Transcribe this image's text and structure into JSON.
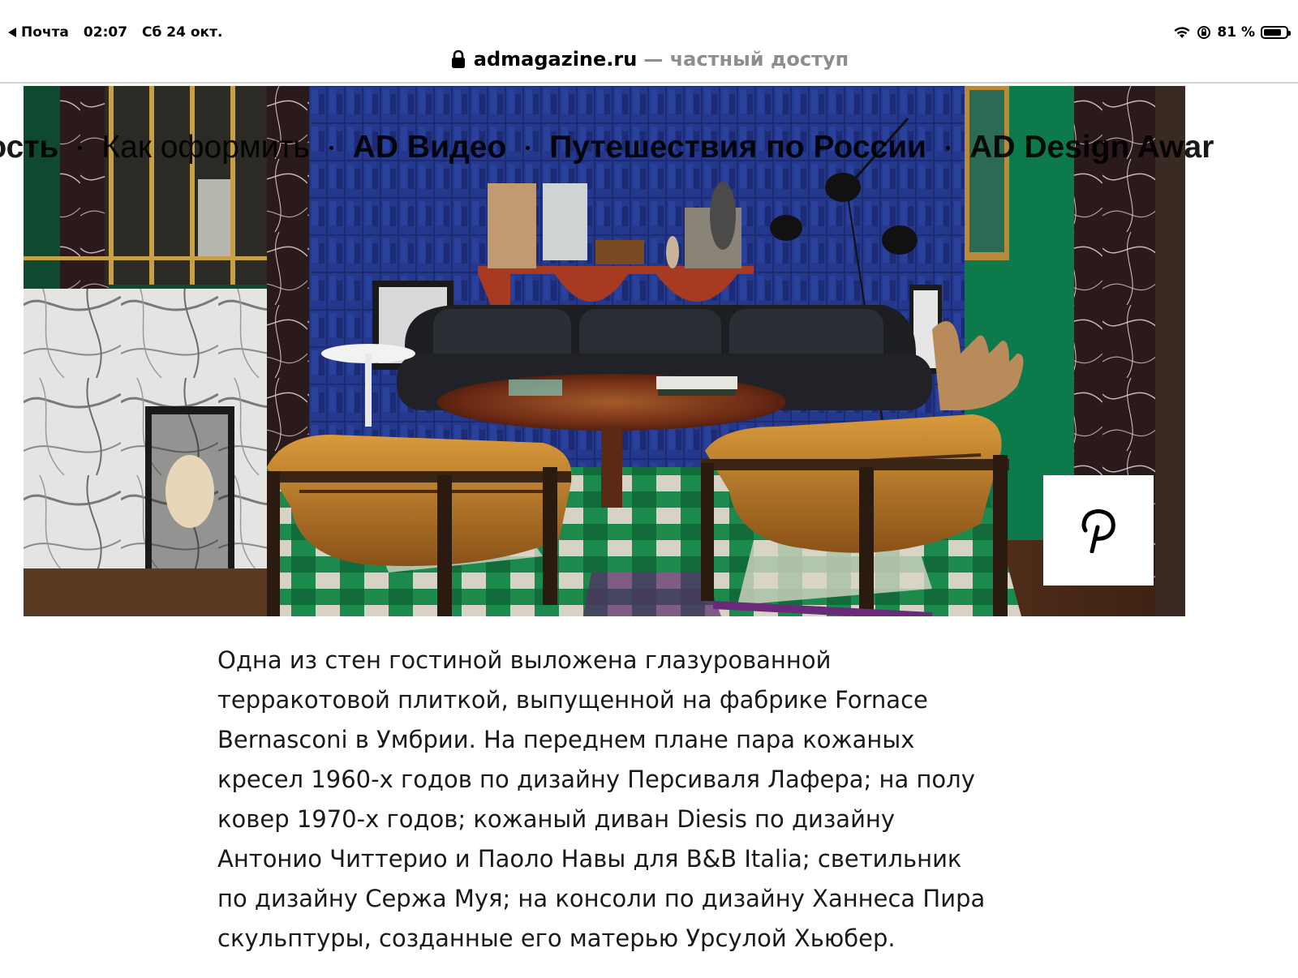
{
  "status_bar": {
    "back_app": "Почта",
    "time": "02:07",
    "date": "Сб 24 окт.",
    "battery_text": "81 %",
    "battery_level": 0.81,
    "icons": [
      "wifi-icon",
      "orientation-lock-icon",
      "battery-icon"
    ]
  },
  "address_bar": {
    "domain": "admagazine.ru",
    "privacy_label": "— частный доступ",
    "icon": "lock-icon"
  },
  "nav": {
    "items": [
      "мость",
      "Как оформить",
      "AD Видео",
      "Путешествия по России",
      "AD Design Awar"
    ]
  },
  "hero": {
    "description": "",
    "share_icon": "pinterest-icon"
  },
  "caption": {
    "lines": [
      "Одна из стен гостиной выложена глазурованной",
      "терракотовой плиткой, выпущенной на фабрике Fornace",
      "Bernasconi в Умбрии. На переднем плане пара кожаных",
      "кресел 1960-х годов по дизайну Персиваля Лафера; на полу",
      "ковер 1970-х годов; кожаный диван Diesis по дизайну",
      "Антонио Читтерио и Паоло Навы для B&B Italia; светильник",
      "по дизайну Сержа Муя; на консоли по дизайну Ханнеса Пира",
      "скульптуры, созданные его матерью Урсулой Хьюбер."
    ]
  },
  "colors": {
    "tile_blue": "#1f2f7a",
    "wall_green": "#0e7a4e",
    "marble": "#d9d9d9",
    "leather_tan": "#c0802c",
    "sofa_black": "#1b1d22",
    "table_wood": "#6b2a14"
  }
}
